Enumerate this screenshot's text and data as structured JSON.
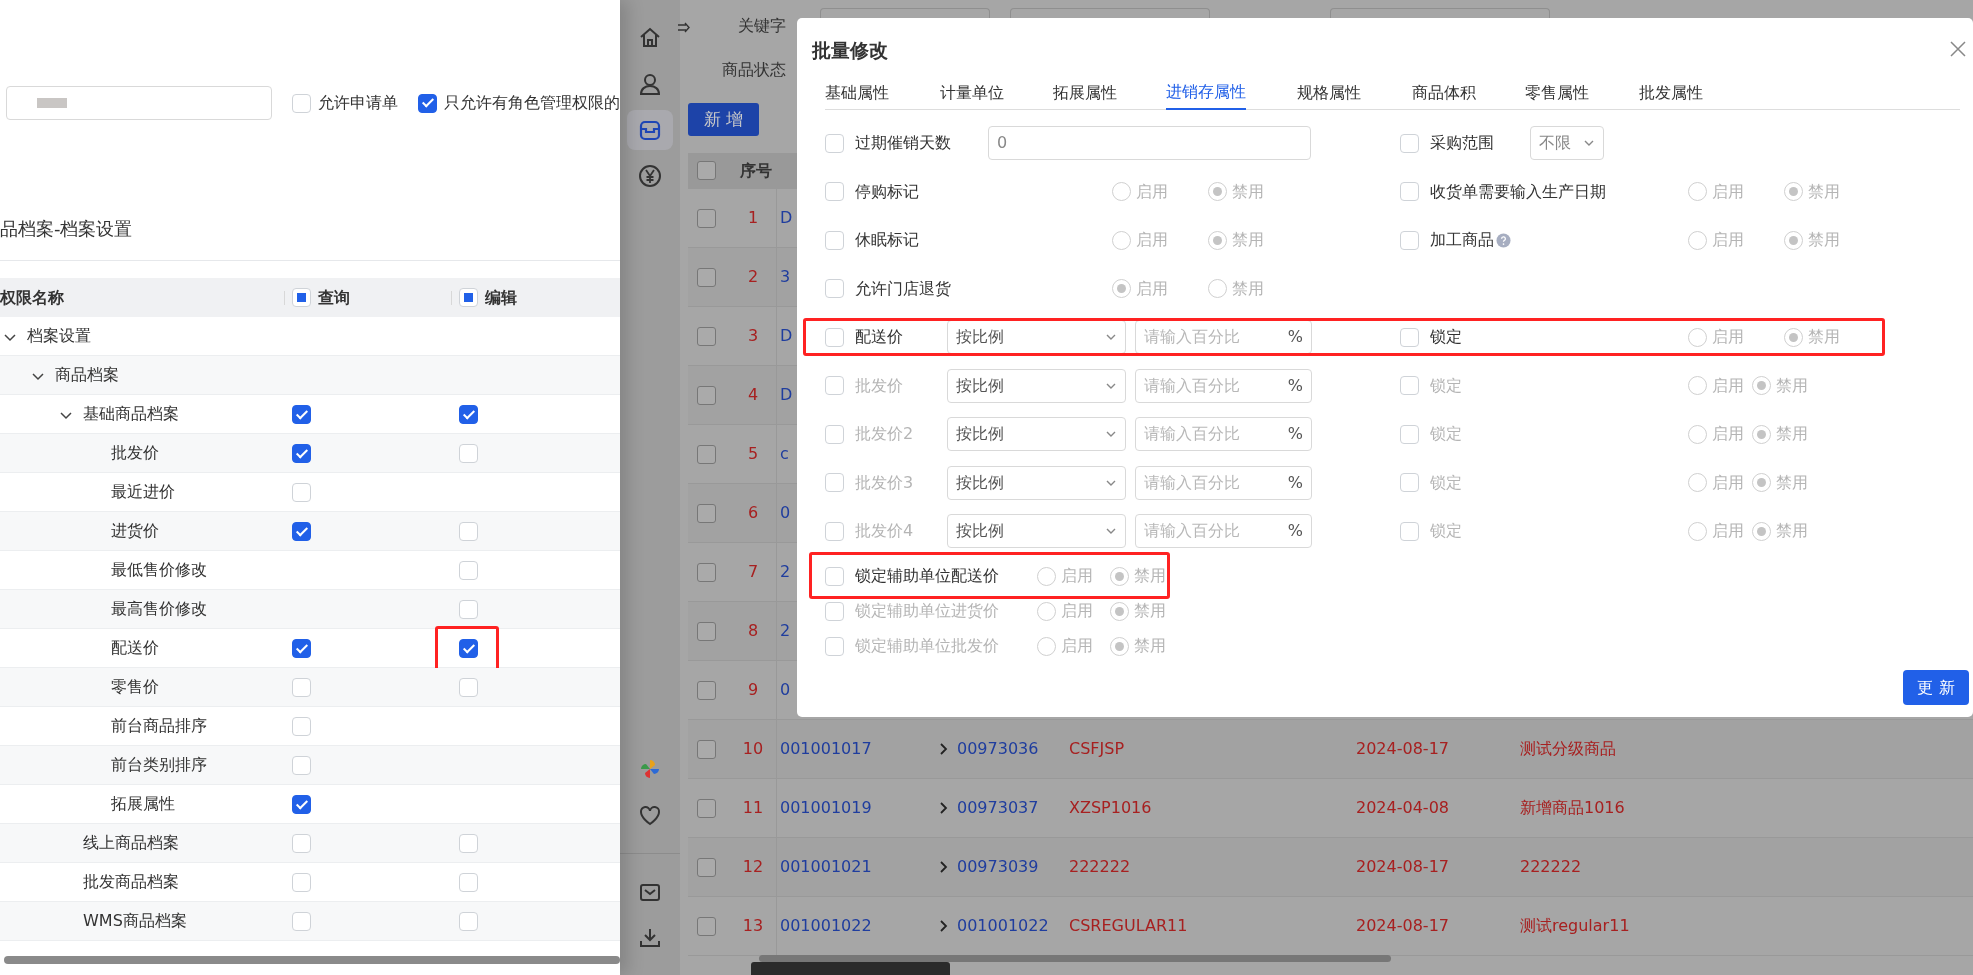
{
  "left_panel": {
    "options": [
      {
        "label": "允许申请单",
        "checked": false
      },
      {
        "label": "只允许有角色管理权限的",
        "checked": true
      }
    ],
    "section_title": "品档案-档案设置",
    "permission_table": {
      "columns": [
        {
          "label": "权限名称"
        },
        {
          "label": "查询",
          "indeterminate": true
        },
        {
          "label": "编辑",
          "indeterminate": true
        }
      ],
      "rows": [
        {
          "name": "档案设置",
          "expanded": true,
          "highlighted": false,
          "children": [
            {
              "name": "商品档案",
              "expanded": true,
              "highlighted": false,
              "children": [
                {
                  "name": "基础商品档案",
                  "expanded": true,
                  "query": true,
                  "edit": true,
                  "highlighted": false,
                  "children": [
                    {
                      "name": "批发价",
                      "query": true,
                      "edit": false,
                      "highlighted": false
                    },
                    {
                      "name": "最近进价",
                      "query": false,
                      "highlighted": false
                    },
                    {
                      "name": "进货价",
                      "query": true,
                      "edit": false,
                      "highlighted": false
                    },
                    {
                      "name": "最低售价修改",
                      "edit": false,
                      "highlighted": false
                    },
                    {
                      "name": "最高售价修改",
                      "edit": false,
                      "highlighted": false
                    },
                    {
                      "name": "配送价",
                      "query": true,
                      "edit": true,
                      "highlighted": true
                    },
                    {
                      "name": "零售价",
                      "query": false,
                      "edit": false,
                      "highlighted": false
                    },
                    {
                      "name": "前台商品排序",
                      "query": false,
                      "highlighted": false
                    },
                    {
                      "name": "前台类别排序",
                      "query": false,
                      "highlighted": false
                    },
                    {
                      "name": "拓展属性",
                      "query": true,
                      "highlighted": false
                    }
                  ]
                },
                {
                  "name": "线上商品档案",
                  "query": false,
                  "edit": false,
                  "highlighted": false
                },
                {
                  "name": "批发商品档案",
                  "query": false,
                  "edit": false,
                  "highlighted": false
                },
                {
                  "name": "WMS商品档案",
                  "query": false,
                  "edit": false,
                  "highlighted": false
                }
              ]
            }
          ]
        }
      ]
    }
  },
  "app": {
    "sidebar_items": [
      {
        "kind": "home",
        "selected": false
      },
      {
        "kind": "user",
        "selected": false
      },
      {
        "kind": "box",
        "selected": true
      },
      {
        "kind": "yen",
        "selected": false
      }
    ],
    "sidebar_bottom_items": [
      {
        "kind": "pinwheel"
      },
      {
        "kind": "heart"
      },
      {
        "kind": "divider"
      },
      {
        "kind": "mail"
      },
      {
        "kind": "download"
      }
    ],
    "filters": [
      {
        "label": "关键字"
      },
      {
        "label": "商品状态"
      }
    ],
    "toolbar_buttons": [
      {
        "label": "新 增"
      }
    ],
    "table": {
      "all_checked": false,
      "columns": [
        {
          "label": "序号"
        }
      ],
      "rows": [
        {
          "no": "1",
          "checked": false,
          "code": "D"
        },
        {
          "no": "2",
          "checked": false,
          "code": "3"
        },
        {
          "no": "3",
          "checked": false,
          "code": "D"
        },
        {
          "no": "4",
          "checked": false,
          "code": "D"
        },
        {
          "no": "5",
          "checked": false,
          "code": "c"
        },
        {
          "no": "6",
          "checked": false,
          "code": "0"
        },
        {
          "no": "7",
          "checked": false,
          "code": "2"
        },
        {
          "no": "8",
          "checked": false,
          "code": "2"
        },
        {
          "no": "9",
          "checked": false,
          "code": "0"
        },
        {
          "no": "10",
          "checked": false,
          "code": "001001017",
          "sub_code": "00973036",
          "column_4": "CSFJSP",
          "date": "2024-08-17",
          "name": "测试分级商品"
        },
        {
          "no": "11",
          "checked": false,
          "code": "001001019",
          "sub_code": "00973037",
          "column_4": "XZSP1016",
          "date": "2024-04-08",
          "name": "新增商品1016"
        },
        {
          "no": "12",
          "checked": false,
          "code": "001001021",
          "sub_code": "00973039",
          "column_4": "222222",
          "date": "2024-08-17",
          "name": "222222"
        },
        {
          "no": "13",
          "checked": false,
          "code": "001001022",
          "sub_code": "001001022",
          "column_4": "CSREGULAR11",
          "date": "2024-08-17",
          "name": "测试regular11"
        }
      ]
    }
  },
  "dialog": {
    "title": "批量修改",
    "tabs": [
      {
        "label": "基础属性",
        "selected": false
      },
      {
        "label": "计量单位",
        "selected": false
      },
      {
        "label": "拓展属性",
        "selected": false
      },
      {
        "label": "进销存属性",
        "selected": true
      },
      {
        "label": "规格属性",
        "selected": false
      },
      {
        "label": "商品体积",
        "selected": false
      },
      {
        "label": "零售属性",
        "selected": false
      },
      {
        "label": "批发属性",
        "selected": false
      }
    ],
    "form_rows": [
      {
        "highlighted": false,
        "left": {
          "kind": "input",
          "label": "过期催销天数",
          "checked": false,
          "disabled": false,
          "value": "0"
        },
        "right": {
          "kind": "select",
          "label": "采购范围",
          "checked": false,
          "disabled": false,
          "value": "不限"
        }
      },
      {
        "highlighted": false,
        "left": {
          "kind": "radio",
          "label": "停购标记",
          "checked": false,
          "disabled": false,
          "options": [
            {
              "label": "启用",
              "selected": false
            },
            {
              "label": "禁用",
              "selected": true
            }
          ]
        },
        "right": {
          "kind": "radio",
          "label": "收货单需要输入生产日期",
          "checked": false,
          "disabled": false,
          "options": [
            {
              "label": "启用",
              "selected": false
            },
            {
              "label": "禁用",
              "selected": true
            }
          ]
        }
      },
      {
        "highlighted": false,
        "left": {
          "kind": "radio",
          "label": "休眠标记",
          "checked": false,
          "disabled": false,
          "options": [
            {
              "label": "启用",
              "selected": false
            },
            {
              "label": "禁用",
              "selected": true
            }
          ]
        },
        "right": {
          "kind": "radio",
          "label": "加工商品",
          "help": true,
          "checked": false,
          "disabled": false,
          "options": [
            {
              "label": "启用",
              "selected": false
            },
            {
              "label": "禁用",
              "selected": true
            }
          ]
        }
      },
      {
        "highlighted": false,
        "left": {
          "kind": "radio",
          "label": "允许门店退货",
          "checked": false,
          "disabled": false,
          "options": [
            {
              "label": "启用",
              "selected": true
            },
            {
              "label": "禁用",
              "selected": false
            }
          ]
        }
      },
      {
        "highlighted": true,
        "left": {
          "kind": "price",
          "label": "配送价",
          "checked": false,
          "disabled": false,
          "mode": "按比例",
          "placeholder": "请输入百分比",
          "unit": "%"
        },
        "right": {
          "kind": "radio",
          "label": "锁定",
          "checked": false,
          "disabled": false,
          "options": [
            {
              "label": "启用",
              "selected": false
            },
            {
              "label": "禁用",
              "selected": true
            }
          ]
        }
      },
      {
        "highlighted": false,
        "left": {
          "kind": "price",
          "label": "批发价",
          "checked": false,
          "disabled": true,
          "mode": "按比例",
          "placeholder": "请输入百分比",
          "unit": "%"
        },
        "right": {
          "kind": "radio",
          "label": "锁定",
          "checked": false,
          "disabled": true,
          "options": [
            {
              "label": "启用",
              "selected": false
            },
            {
              "label": "禁用",
              "selected": true
            }
          ]
        }
      },
      {
        "highlighted": false,
        "left": {
          "kind": "price",
          "label": "批发价2",
          "checked": false,
          "disabled": true,
          "mode": "按比例",
          "placeholder": "请输入百分比",
          "unit": "%"
        },
        "right": {
          "kind": "radio",
          "label": "锁定",
          "checked": false,
          "disabled": true,
          "options": [
            {
              "label": "启用",
              "selected": false
            },
            {
              "label": "禁用",
              "selected": true
            }
          ]
        }
      },
      {
        "highlighted": false,
        "left": {
          "kind": "price",
          "label": "批发价3",
          "checked": false,
          "disabled": true,
          "mode": "按比例",
          "placeholder": "请输入百分比",
          "unit": "%"
        },
        "right": {
          "kind": "radio",
          "label": "锁定",
          "checked": false,
          "disabled": true,
          "options": [
            {
              "label": "启用",
              "selected": false
            },
            {
              "label": "禁用",
              "selected": true
            }
          ]
        }
      },
      {
        "highlighted": false,
        "left": {
          "kind": "price",
          "label": "批发价4",
          "checked": false,
          "disabled": true,
          "mode": "按比例",
          "placeholder": "请输入百分比",
          "unit": "%"
        },
        "right": {
          "kind": "radio",
          "label": "锁定",
          "checked": false,
          "disabled": true,
          "options": [
            {
              "label": "启用",
              "selected": false
            },
            {
              "label": "禁用",
              "selected": true
            }
          ]
        }
      }
    ],
    "lock_rows": [
      {
        "label": "锁定辅助单位配送价",
        "checked": false,
        "disabled": false,
        "highlighted": true,
        "options": [
          {
            "label": "启用",
            "selected": false
          },
          {
            "label": "禁用",
            "selected": true
          }
        ]
      },
      {
        "label": "锁定辅助单位进货价",
        "checked": false,
        "disabled": true,
        "highlighted": false,
        "options": [
          {
            "label": "启用",
            "selected": false
          },
          {
            "label": "禁用",
            "selected": true
          }
        ]
      },
      {
        "label": "锁定辅助单位批发价",
        "checked": false,
        "disabled": true,
        "highlighted": false,
        "options": [
          {
            "label": "启用",
            "selected": false
          },
          {
            "label": "禁用",
            "selected": true
          }
        ]
      }
    ],
    "update_button": "更 新"
  }
}
